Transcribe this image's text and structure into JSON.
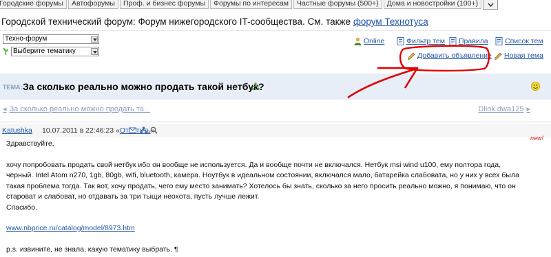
{
  "tabs": [
    "Городские форумы",
    "Автофорумы",
    "Проф. и бизнес форумы",
    "Форумы по интересам",
    "Частные форумы (500+)",
    "Дома и новостройки (100+)"
  ],
  "forum": {
    "title_prefix": "Городской технический форум: Форум нижегородского IT-сообщества. См. также ",
    "title_link": "форум Технотуса"
  },
  "header": {
    "forum_select": "Техно-форум",
    "theme_select": "Выберите тематику",
    "links": {
      "online": "Online",
      "filter": "Фильтр тем",
      "rules": "Правила",
      "topics": "Список тем",
      "add_ad": "Добавить объявление",
      "new_topic": "Новая тема"
    }
  },
  "topic": {
    "label": "ТЕМА:",
    "title": "За сколько реально можно продать такой нетбук?"
  },
  "prevnext": {
    "prev": "За сколько реально можно продать та...",
    "next": "Dlink dwa125"
  },
  "post": {
    "author": "Katushka",
    "date": "10.07.2011 в 22:46:23",
    "reply_open": "«",
    "reply": "Ответить",
    "reply_close": "»",
    "new_badge": "new!",
    "greeting": "Здравствуйте,",
    "body1": "хочу попробовать продать свой нетбук ибо он вообще не используется. Да и вообще почти не включался. Нетбук msi wind u100, ему полтора года, черный. Intel Atom n270, 1gb, 80gb, wifi, bluetooth, камера. Ноутбук в идеальном состоянии, включался мало, батарейка слабовата, но у них у всех была такая проблема тогда. Так вот, хочу продать, чего ему место занимать? Хотелось бы знать, сколько за него просить реально можно, я понимаю, что он староват и слабоват, но отдавать за три тыщи неохота, пусть лучше лежит.",
    "thanks": "Спасибо.",
    "link": "www.nbprice.ru/catalog/model/8973.htm",
    "ps": "p.s. извините, не знала, какую тематику выбрать. ¶"
  },
  "colors": {
    "link": "#2457a6",
    "annotation": "#e00000",
    "topic_bar": "#e8eef7"
  }
}
